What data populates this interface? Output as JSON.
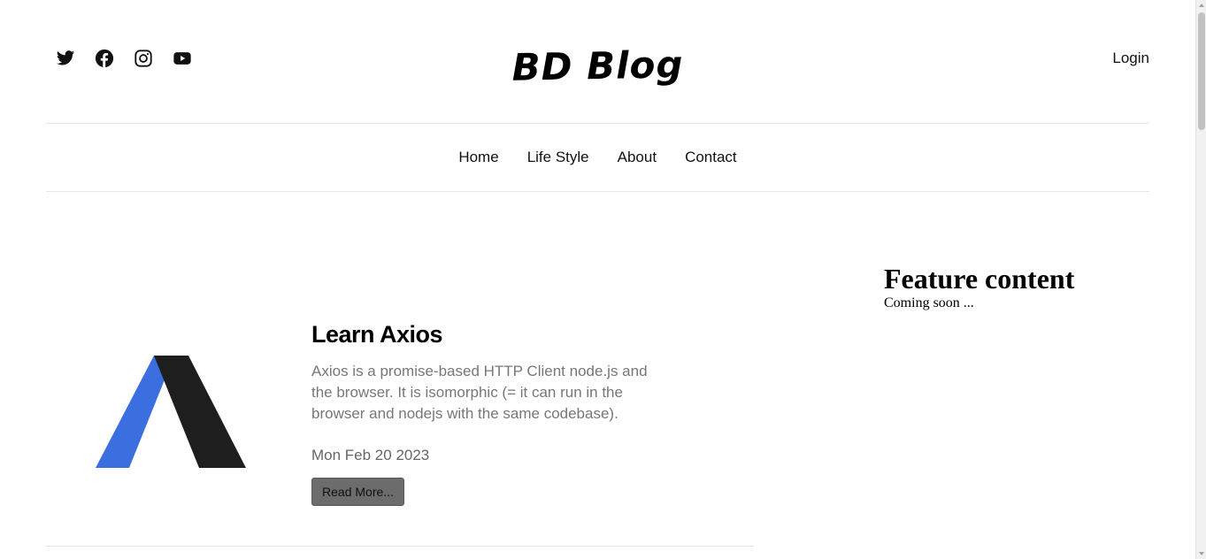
{
  "header": {
    "brand": "BD Blog",
    "login_label": "Login",
    "social_icons": [
      "twitter-icon",
      "facebook-icon",
      "instagram-icon",
      "youtube-icon"
    ]
  },
  "nav": {
    "items": [
      {
        "label": "Home"
      },
      {
        "label": "Life Style"
      },
      {
        "label": "About"
      },
      {
        "label": "Contact"
      }
    ]
  },
  "post": {
    "title": "Learn Axios",
    "excerpt": "Axios is a promise-based HTTP Client node.js and the browser. It is isomorphic (= it can run in the browser and nodejs with the same codebase).",
    "date": "Mon Feb 20 2023",
    "read_more_label": "Read More...",
    "logo_colors": {
      "left": "#3b6fe0",
      "right": "#1e1e1e"
    }
  },
  "sidebar": {
    "feature_title": "Feature content",
    "feature_text": "Coming soon ..."
  }
}
